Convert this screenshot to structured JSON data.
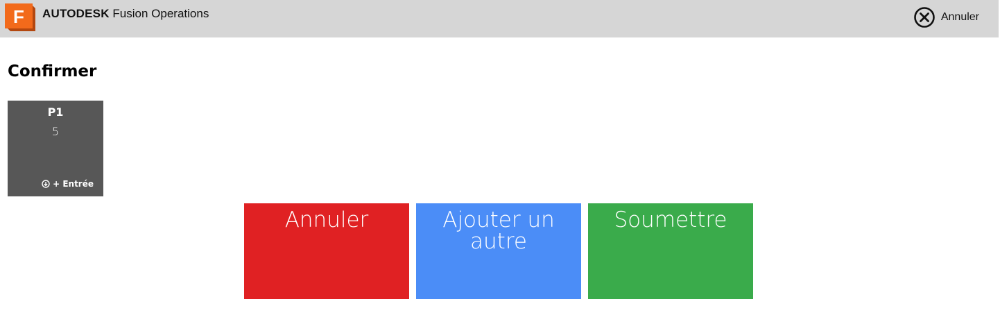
{
  "header": {
    "brand_strong": "AUTODESK",
    "brand_light": "Fusion Operations",
    "logo_letter": "F",
    "cancel_label": "Annuler",
    "cancel_icon": "close-circle-icon"
  },
  "page": {
    "title": "Confirmer"
  },
  "tile": {
    "name": "P1",
    "value": "5",
    "entry_label": "+ Entrée",
    "entry_icon": "arrow-down-circle-icon"
  },
  "actions": {
    "cancel_label": "Annuler",
    "add_label": "Ajouter un autre",
    "submit_label": "Soumettre"
  },
  "colors": {
    "topbar": "#d6d6d6",
    "logo_orange": "#f26a1b",
    "tile_bg": "#575757",
    "cancel_red": "#e02123",
    "add_blue": "#4b8df7",
    "submit_green": "#3aab4b"
  }
}
